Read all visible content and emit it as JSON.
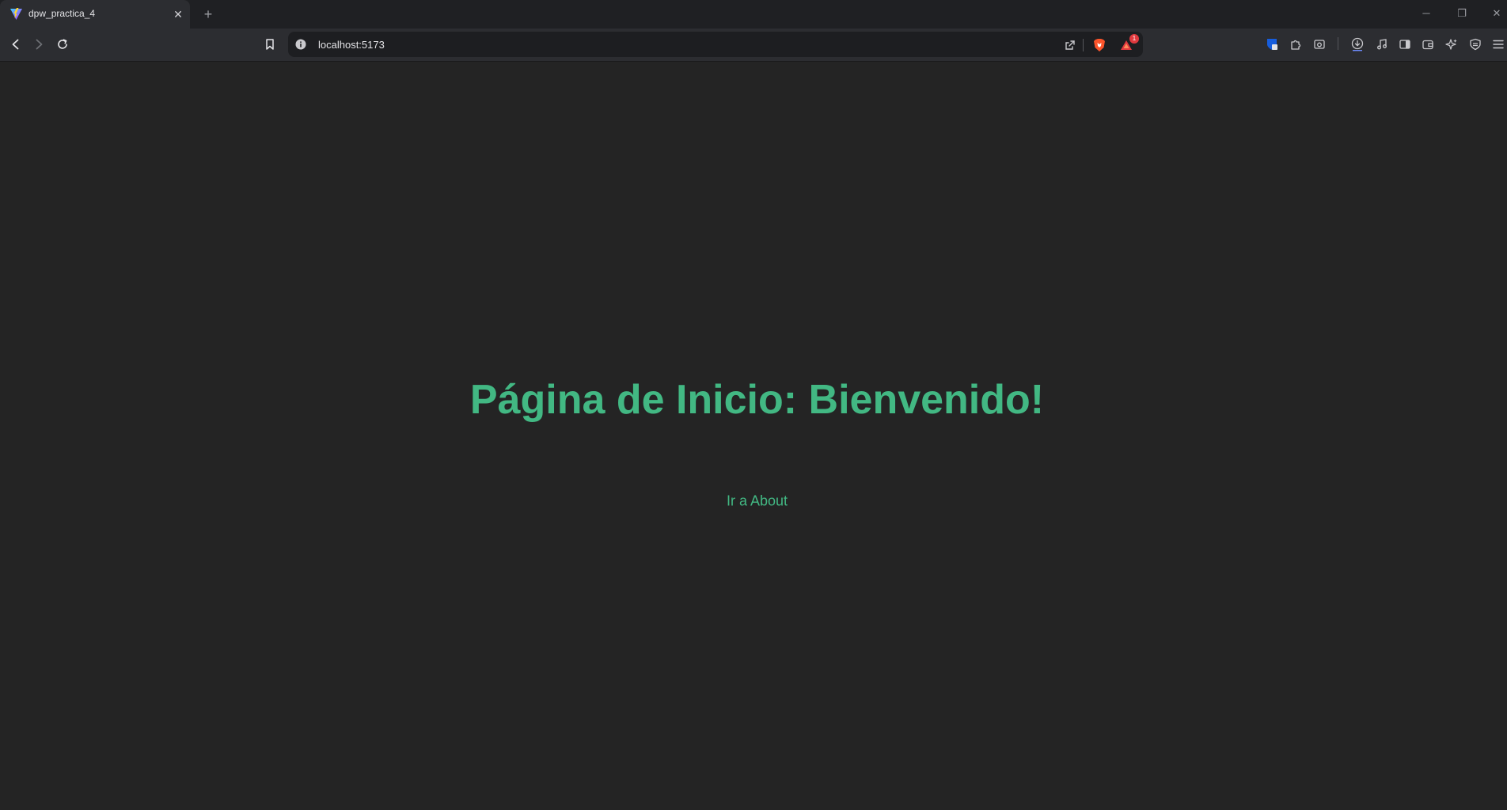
{
  "browser": {
    "tab": {
      "title": "dpw_practica_4",
      "close_symbol": "✕",
      "favicon": "vite-logo-icon"
    },
    "new_tab_symbol": "+",
    "window_controls": {
      "minimize": "─",
      "restore": "❐",
      "close": "✕"
    },
    "address_bar": {
      "url": "localhost:5173"
    },
    "shields_badge": "1",
    "icons": [
      "back-icon",
      "forward-icon",
      "reload-icon",
      "bookmark-icon",
      "site-info-icon",
      "share-icon",
      "brave-shields-icon",
      "brave-rewards-icon",
      "bitwarden-icon",
      "extensions-icon",
      "screenshot-icon",
      "downloads-icon",
      "media-icon",
      "sidebar-icon",
      "wallet-icon",
      "leo-ai-icon",
      "vpn-icon",
      "menu-icon"
    ]
  },
  "page": {
    "title": "Página de Inicio: Bienvenido!",
    "link_label": "Ir a About"
  },
  "colors": {
    "accent": "#42b883",
    "background": "#242424",
    "chrome": "#2c2d31"
  }
}
